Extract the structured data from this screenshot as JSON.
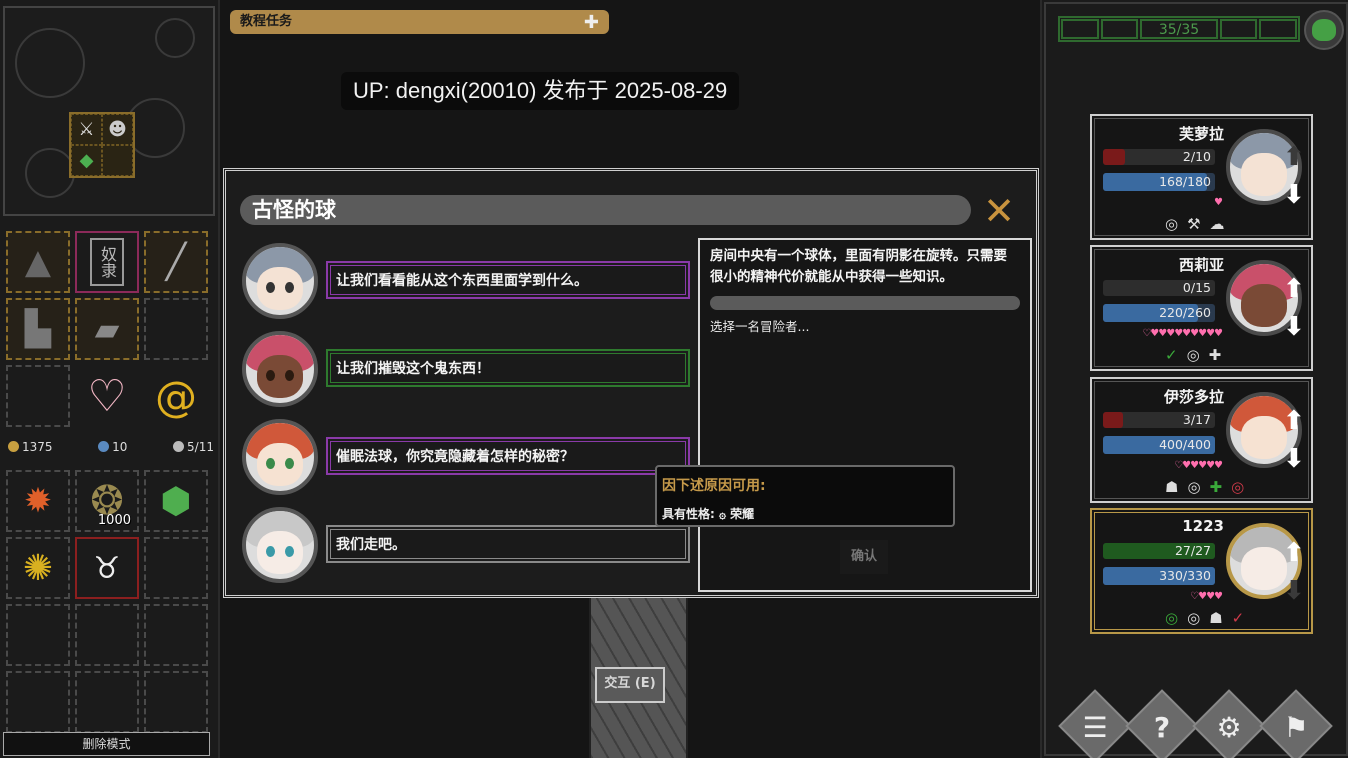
{
  "quest_panel": {
    "title": "教程任务"
  },
  "watermark": {
    "text": "UP: dengxi(20010) 发布于 2025-08-29"
  },
  "event": {
    "title": "古怪的球",
    "description": "房间中央有一个球体，里面有阴影在旋转。只需要很小的精神代价就能从中获得一些知识。",
    "prompt": "选择一名冒险者...",
    "confirm_label": "确认",
    "choices": [
      {
        "text": "让我们看看能从这个东西里面学到什么。",
        "style": "purple"
      },
      {
        "text": "让我们摧毁这个鬼东西！",
        "style": "green"
      },
      {
        "text": "催眠法球，你究竟隐藏着怎样的秘密？",
        "style": "purple"
      },
      {
        "text": "我们走吧。",
        "style": "grey"
      }
    ]
  },
  "tooltip": {
    "title": "因下述原因可用:",
    "body": "具有性格: ۞ 荣耀"
  },
  "interact": {
    "label": "交互 (E)"
  },
  "inventory": {
    "resources": {
      "gold": "1375",
      "gems": "10",
      "capacity": "5/11"
    },
    "stack_count": "1000",
    "delete_mode_label": "删除模式"
  },
  "day_counter": {
    "text": "35/35"
  },
  "heroes": [
    {
      "name": "芙萝拉",
      "hp": "2/10",
      "hp_ratio": 0.2,
      "mp": "168/180",
      "mp_ratio": 0.93,
      "hearts": "♥",
      "traits": [
        "◎",
        "⚒",
        "☁"
      ],
      "hair": "#8c98a8"
    },
    {
      "name": "西莉亚",
      "hp": "0/15",
      "hp_ratio": 0.0,
      "mp": "220/260",
      "mp_ratio": 0.85,
      "hearts": "♡♥♥♥♥♥♥♥♥♥",
      "traits": [
        "✓",
        "◎",
        "✚"
      ],
      "hair": "#c9506a"
    },
    {
      "name": "伊莎多拉",
      "hp": "3/17",
      "hp_ratio": 0.18,
      "mp": "400/400",
      "mp_ratio": 1.0,
      "hearts": "♡♥♥♥♥♥",
      "traits": [
        "☗",
        "◎",
        "✚",
        "◎"
      ],
      "hair": "#d0583a"
    },
    {
      "name": "1223",
      "hp": "27/27",
      "hp_ratio": 1.0,
      "mp": "330/330",
      "mp_ratio": 1.0,
      "hearts": "♡♥♥♥",
      "traits": [
        "◎",
        "◎",
        "☗",
        "✓"
      ],
      "hair": "#b8b8b8"
    }
  ],
  "menu": {
    "items": [
      "list-icon",
      "help-icon",
      "settings-icon",
      "flag-icon"
    ]
  },
  "colors": {
    "accent_gold": "#c8933e",
    "hp_red": "#7a1a1a",
    "mp_blue": "#3a6aa0",
    "green_ok": "#2f8a2f"
  }
}
